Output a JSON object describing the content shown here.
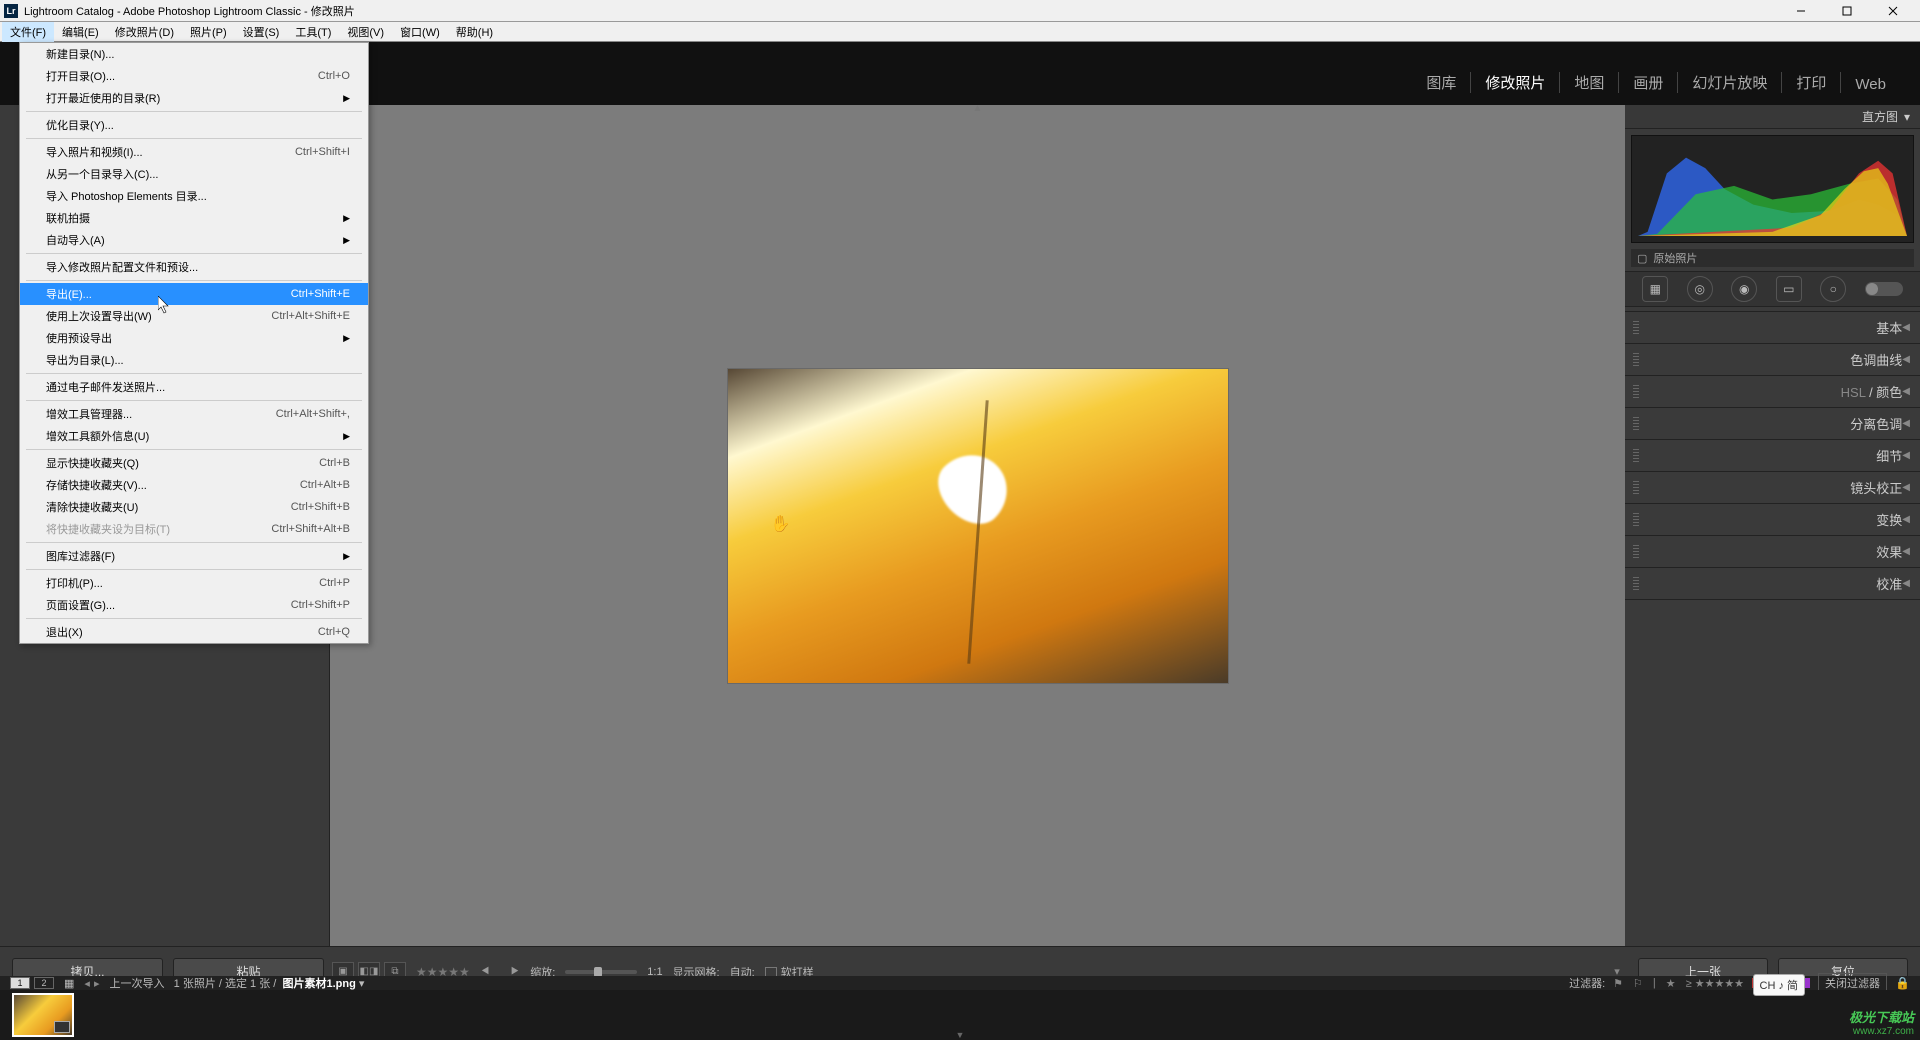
{
  "window": {
    "title": "Lightroom Catalog - Adobe Photoshop Lightroom Classic - 修改照片"
  },
  "menubar": {
    "items": [
      "文件(F)",
      "编辑(E)",
      "修改照片(D)",
      "照片(P)",
      "设置(S)",
      "工具(T)",
      "视图(V)",
      "窗口(W)",
      "帮助(H)"
    ],
    "activeIndex": 0
  },
  "modules": {
    "items": [
      "图库",
      "修改照片",
      "地图",
      "画册",
      "幻灯片放映",
      "打印",
      "Web"
    ],
    "activeIndex": 1
  },
  "fileMenu": {
    "groups": [
      [
        {
          "label": "新建目录(N)...",
          "shortcut": "",
          "sub": false
        },
        {
          "label": "打开目录(O)...",
          "shortcut": "Ctrl+O",
          "sub": false
        },
        {
          "label": "打开最近使用的目录(R)",
          "shortcut": "",
          "sub": true
        }
      ],
      [
        {
          "label": "优化目录(Y)...",
          "shortcut": "",
          "sub": false
        }
      ],
      [
        {
          "label": "导入照片和视频(I)...",
          "shortcut": "Ctrl+Shift+I",
          "sub": false
        },
        {
          "label": "从另一个目录导入(C)...",
          "shortcut": "",
          "sub": false
        },
        {
          "label": "导入 Photoshop Elements 目录...",
          "shortcut": "",
          "sub": false
        },
        {
          "label": "联机拍摄",
          "shortcut": "",
          "sub": true
        },
        {
          "label": "自动导入(A)",
          "shortcut": "",
          "sub": true
        }
      ],
      [
        {
          "label": "导入修改照片配置文件和预设...",
          "shortcut": "",
          "sub": false
        }
      ],
      [
        {
          "label": "导出(E)...",
          "shortcut": "Ctrl+Shift+E",
          "sub": false,
          "highlighted": true
        },
        {
          "label": "使用上次设置导出(W)",
          "shortcut": "Ctrl+Alt+Shift+E",
          "sub": false
        },
        {
          "label": "使用预设导出",
          "shortcut": "",
          "sub": true
        },
        {
          "label": "导出为目录(L)...",
          "shortcut": "",
          "sub": false
        }
      ],
      [
        {
          "label": "通过电子邮件发送照片...",
          "shortcut": "",
          "sub": false
        }
      ],
      [
        {
          "label": "增效工具管理器...",
          "shortcut": "Ctrl+Alt+Shift+,",
          "sub": false
        },
        {
          "label": "增效工具额外信息(U)",
          "shortcut": "",
          "sub": true
        }
      ],
      [
        {
          "label": "显示快捷收藏夹(Q)",
          "shortcut": "Ctrl+B",
          "sub": false
        },
        {
          "label": "存储快捷收藏夹(V)...",
          "shortcut": "Ctrl+Alt+B",
          "sub": false
        },
        {
          "label": "清除快捷收藏夹(U)",
          "shortcut": "Ctrl+Shift+B",
          "sub": false
        },
        {
          "label": "将快捷收藏夹设为目标(T)",
          "shortcut": "Ctrl+Shift+Alt+B",
          "sub": false,
          "disabled": true
        }
      ],
      [
        {
          "label": "图库过滤器(F)",
          "shortcut": "",
          "sub": true
        }
      ],
      [
        {
          "label": "打印机(P)...",
          "shortcut": "Ctrl+P",
          "sub": false
        },
        {
          "label": "页面设置(G)...",
          "shortcut": "Ctrl+Shift+P",
          "sub": false
        }
      ],
      [
        {
          "label": "退出(X)",
          "shortcut": "Ctrl+Q",
          "sub": false
        }
      ]
    ]
  },
  "rightPanel": {
    "histogramTitle": "直方图",
    "originalLabel": "原始照片",
    "sections": [
      "基本",
      "色调曲线",
      "HSL / 颜色",
      "分离色调",
      "细节",
      "镜头校正",
      "变换",
      "效果",
      "校准"
    ],
    "hslDim": "HSL",
    "hslRest": " / 颜色"
  },
  "toolbar": {
    "copy": "拷贝...",
    "paste": "粘贴",
    "zoomLabel": "缩放:",
    "fitLabel": "1:1",
    "gridLabel": "显示网格:",
    "autoLabel": "自动:",
    "softProof": "软打样",
    "prev": "上一张",
    "reset": "复位"
  },
  "filmstrip": {
    "filterLabel": "过滤器:",
    "closeFilter": "关闭过滤器",
    "crumbPrefix": "上一次导入",
    "crumbCounts": "1 张照片 / 选定 1 张 /",
    "crumbFile": "图片素材1.png",
    "screen1": "1",
    "screen2": "2"
  },
  "ime": "CH ♪ 简",
  "watermark": {
    "brand": "极光下载站",
    "url": "www.xz7.com"
  }
}
